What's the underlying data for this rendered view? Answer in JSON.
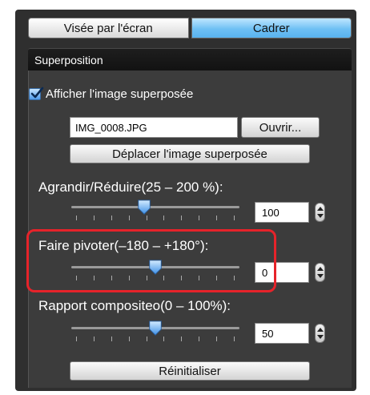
{
  "tabs": {
    "screen_view": "Visée par l'écran",
    "frame": "Cadrer"
  },
  "panel": {
    "title": "Superposition",
    "show_overlay_label": "Afficher l'image superposée",
    "show_overlay_checked": true,
    "file_name": "IMG_0008.JPG",
    "open_button": "Ouvrir...",
    "move_button": "Déplacer l'image superposée",
    "reset_button": "Réinitialiser"
  },
  "sliders": {
    "zoom": {
      "label": "Agrandir/Réduire(25 – 200 %):",
      "value": "100",
      "min": 25,
      "max": 200
    },
    "rotate": {
      "label": "Faire pivoter(–180 – +180°):",
      "value": "0",
      "min": -180,
      "max": 180
    },
    "composite": {
      "label": "Rapport compositeo(0 – 100%):",
      "value": "50",
      "min": 0,
      "max": 100
    }
  },
  "colors": {
    "active_tab": "#6fc0f4",
    "highlight": "#e6232a",
    "panel_bg": "#3c3c3c"
  }
}
